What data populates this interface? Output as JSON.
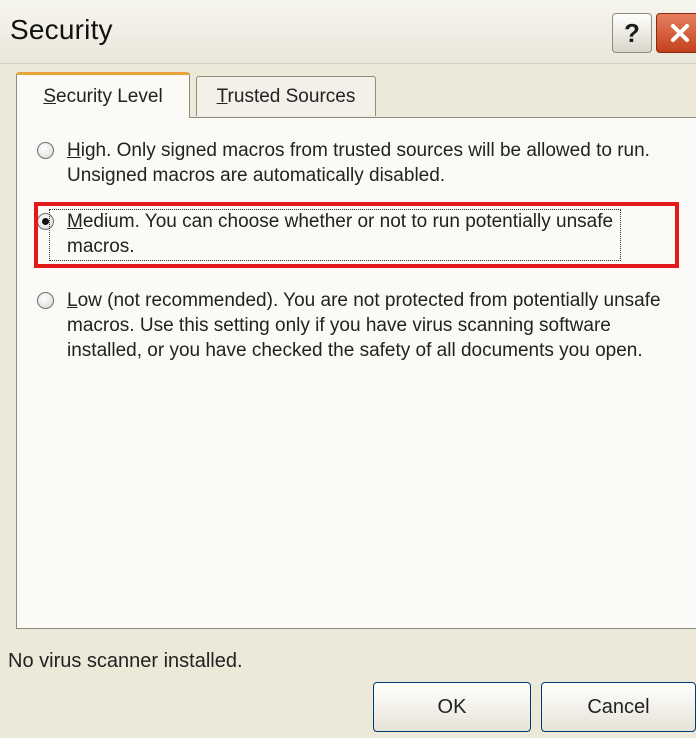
{
  "window": {
    "title": "Security",
    "help_label": "?"
  },
  "tabs": [
    {
      "label": "Security Level",
      "mnemonic": "S",
      "rest": "ecurity Level",
      "selected": true
    },
    {
      "label": "Trusted Sources",
      "mnemonic": "T",
      "rest": "rusted Sources",
      "selected": false
    }
  ],
  "options": {
    "high": {
      "mnemonic": "H",
      "rest": "igh. Only signed macros from trusted sources will be allowed to run. Unsigned macros are automatically disabled.",
      "checked": false
    },
    "medium": {
      "mnemonic": "M",
      "rest": "edium. You can choose whether or not to run potentially unsafe macros.",
      "checked": true
    },
    "low": {
      "mnemonic": "L",
      "rest": "ow (not recommended). You are not protected from potentially unsafe macros. Use this setting only if you have virus scanning software installed, or you have checked the safety of all documents you open.",
      "checked": false
    }
  },
  "status": {
    "text": "No virus scanner installed."
  },
  "buttons": {
    "ok": "OK",
    "cancel": "Cancel"
  },
  "colors": {
    "highlight": "#E21A1A",
    "dialog_bg": "#ECE9D8",
    "close_button": "#C4411D"
  }
}
